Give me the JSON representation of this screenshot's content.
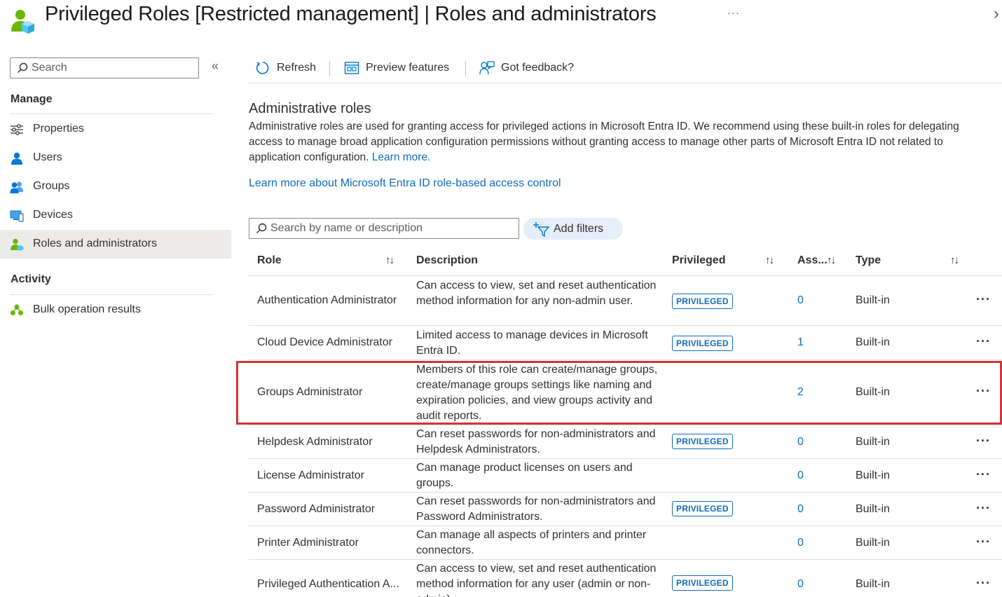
{
  "header": {
    "title": "Privileged Roles [Restricted management] | Roles and administrators",
    "more": "···",
    "close": "›"
  },
  "nav": {
    "search_placeholder": "Search",
    "collapse": "«",
    "manage_label": "Manage",
    "manage_items": [
      {
        "label": "Properties",
        "icon": "properties-icon"
      },
      {
        "label": "Users",
        "icon": "user-icon"
      },
      {
        "label": "Groups",
        "icon": "groups-icon"
      },
      {
        "label": "Devices",
        "icon": "devices-icon"
      },
      {
        "label": "Roles and administrators",
        "icon": "roles-icon",
        "selected": true
      }
    ],
    "activity_label": "Activity",
    "activity_items": [
      {
        "label": "Bulk operation results",
        "icon": "bulk-icon"
      }
    ]
  },
  "toolbar": {
    "refresh": "Refresh",
    "preview": "Preview features",
    "feedback": "Got feedback?"
  },
  "content": {
    "title": "Administrative roles",
    "description": "Administrative roles are used for granting access for privileged actions in Microsoft Entra ID. We recommend using these built-in roles for delegating access to manage broad application configuration permissions without granting access to manage other parts of Microsoft Entra ID not related to application configuration.",
    "learn_more": "Learn more.",
    "rbac_link": "Learn more about Microsoft Entra ID role-based access control",
    "search_placeholder": "Search by name or description",
    "add_filters": "Add filters"
  },
  "table": {
    "columns": {
      "role": "Role",
      "description": "Description",
      "privileged": "Privileged",
      "assignments": "Ass...",
      "type": "Type"
    },
    "sort_glyph": "↑↓",
    "badge_label": "PRIVILEGED",
    "more_glyph": "···",
    "rows": [
      {
        "role": "Authentication Administrator",
        "description": "Can access to view, set and reset authentication method information for any non-admin user.",
        "privileged": true,
        "assignments": "0",
        "type": "Built-in"
      },
      {
        "role": "Cloud Device Administrator",
        "description": "Limited access to manage devices in Microsoft Entra ID.",
        "privileged": true,
        "assignments": "1",
        "type": "Built-in"
      },
      {
        "role": "Groups Administrator",
        "description": "Members of this role can create/manage groups, create/manage groups settings like naming and expiration policies, and view groups activity and audit reports.",
        "privileged": false,
        "assignments": "2",
        "type": "Built-in",
        "highlighted": true
      },
      {
        "role": "Helpdesk Administrator",
        "description": "Can reset passwords for non-administrators and Helpdesk Administrators.",
        "privileged": true,
        "assignments": "0",
        "type": "Built-in"
      },
      {
        "role": "License Administrator",
        "description": "Can manage product licenses on users and groups.",
        "privileged": false,
        "assignments": "0",
        "type": "Built-in"
      },
      {
        "role": "Password Administrator",
        "description": "Can reset passwords for non-administrators and Password Administrators.",
        "privileged": true,
        "assignments": "0",
        "type": "Built-in"
      },
      {
        "role": "Printer Administrator",
        "description": "Can manage all aspects of printers and printer connectors.",
        "privileged": false,
        "assignments": "0",
        "type": "Built-in"
      },
      {
        "role": "Privileged Authentication A...",
        "description": "Can access to view, set and reset authentication method information for any user (admin or non-admin).",
        "privileged": true,
        "assignments": "0",
        "type": "Built-in"
      }
    ]
  },
  "colors": {
    "accent": "#0f6cbd",
    "highlight": "#d13438",
    "selected_bg": "#edebe9",
    "filter_bg": "#e5eef9"
  }
}
